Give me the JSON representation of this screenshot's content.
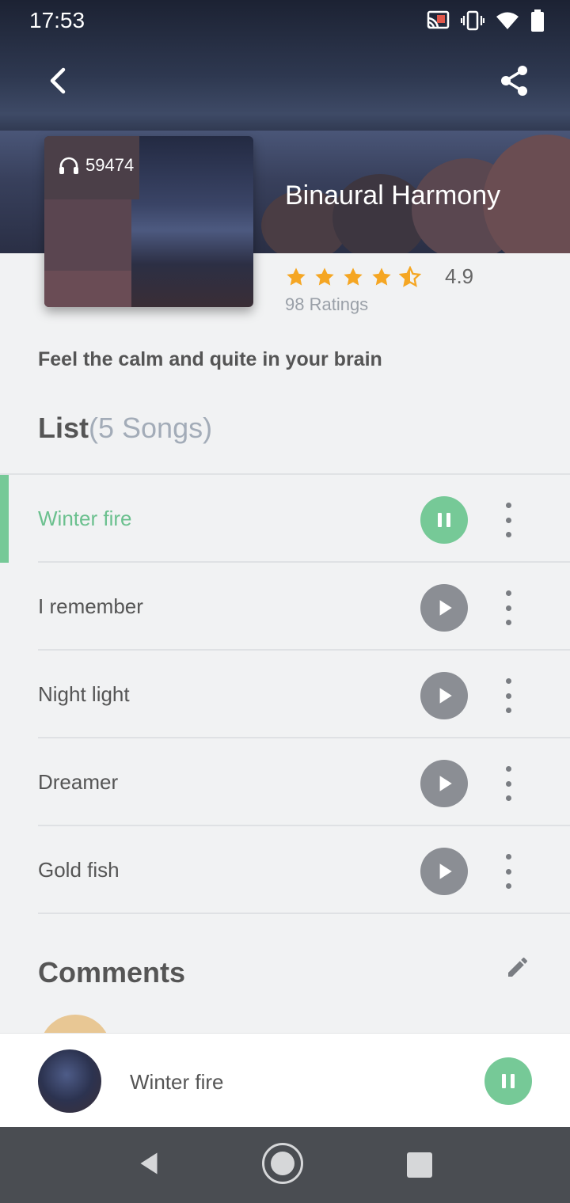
{
  "status": {
    "time": "17:53"
  },
  "album": {
    "title": "Binaural Harmony",
    "listens": "59474",
    "rating": "4.9",
    "stars": 4.5,
    "ratings_count": "98 Ratings",
    "description": "Feel the calm and quite in your brain"
  },
  "list": {
    "label": "List",
    "count": "(5 Songs)",
    "songs": [
      {
        "name": "Winter fire",
        "state": "playing"
      },
      {
        "name": "I remember",
        "state": "paused"
      },
      {
        "name": "Night light",
        "state": "paused"
      },
      {
        "name": "Dreamer",
        "state": "paused"
      },
      {
        "name": "Gold fish",
        "state": "paused"
      }
    ]
  },
  "comments": {
    "label": "Comments"
  },
  "mini_player": {
    "track": "Winter fire"
  },
  "colors": {
    "accent": "#76c997",
    "star": "#f5a623"
  }
}
